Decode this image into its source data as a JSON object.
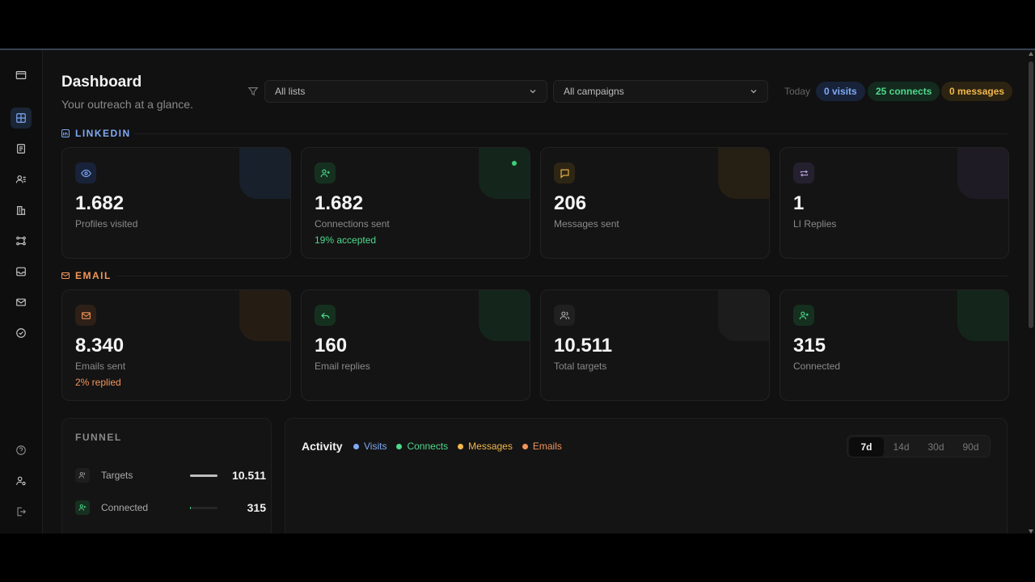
{
  "header": {
    "title": "Dashboard",
    "subtitle": "Your outreach at a glance."
  },
  "filters": {
    "lists": "All lists",
    "campaigns": "All campaigns",
    "today": "Today",
    "pills": [
      {
        "label": "0 visits",
        "color": "#7fa9f5",
        "bg": "#182339"
      },
      {
        "label": "25 connects",
        "color": "#4cd98c",
        "bg": "#142a1e"
      },
      {
        "label": "0 messages",
        "color": "#f2b84b",
        "bg": "#2c2312"
      }
    ]
  },
  "sections": {
    "linkedin": "LINKEDIN",
    "email": "EMAIL"
  },
  "linkedin_cards": [
    {
      "value": "1.682",
      "label": "Profiles visited",
      "sub": "",
      "icon": "eye-icon",
      "accent": "#7fa9f5"
    },
    {
      "value": "1.682",
      "label": "Connections sent",
      "sub": "19% accepted",
      "icon": "user-plus-icon",
      "accent": "#4cd98c"
    },
    {
      "value": "206",
      "label": "Messages sent",
      "sub": "",
      "icon": "message-icon",
      "accent": "#f2b84b"
    },
    {
      "value": "1",
      "label": "LI Replies",
      "sub": "",
      "icon": "repeat-icon",
      "accent": "#b39ddb"
    }
  ],
  "email_cards": [
    {
      "value": "8.340",
      "label": "Emails sent",
      "sub": "2% replied",
      "icon": "mail-icon",
      "accent": "#f2955b"
    },
    {
      "value": "160",
      "label": "Email replies",
      "sub": "",
      "icon": "reply-icon",
      "accent": "#4cd98c"
    },
    {
      "value": "10.511",
      "label": "Total targets",
      "sub": "",
      "icon": "users-icon",
      "accent": "#999999"
    },
    {
      "value": "315",
      "label": "Connected",
      "sub": "",
      "icon": "user-plus-icon",
      "accent": "#4cd98c"
    }
  ],
  "funnel": {
    "title": "FUNNEL",
    "rows": [
      {
        "label": "Targets",
        "value": "10.511",
        "fill": 1.0,
        "color": "#bdbdbd"
      },
      {
        "label": "Connected",
        "value": "315",
        "fill": 0.03,
        "color": "#4cd98c"
      }
    ]
  },
  "activity": {
    "title": "Activity",
    "legend": [
      {
        "label": "Visits",
        "color": "#7fa9f5"
      },
      {
        "label": "Connects",
        "color": "#4cd98c"
      },
      {
        "label": "Messages",
        "color": "#f2b84b"
      },
      {
        "label": "Emails",
        "color": "#f2955b"
      }
    ],
    "ranges": [
      "7d",
      "14d",
      "30d",
      "90d"
    ]
  }
}
